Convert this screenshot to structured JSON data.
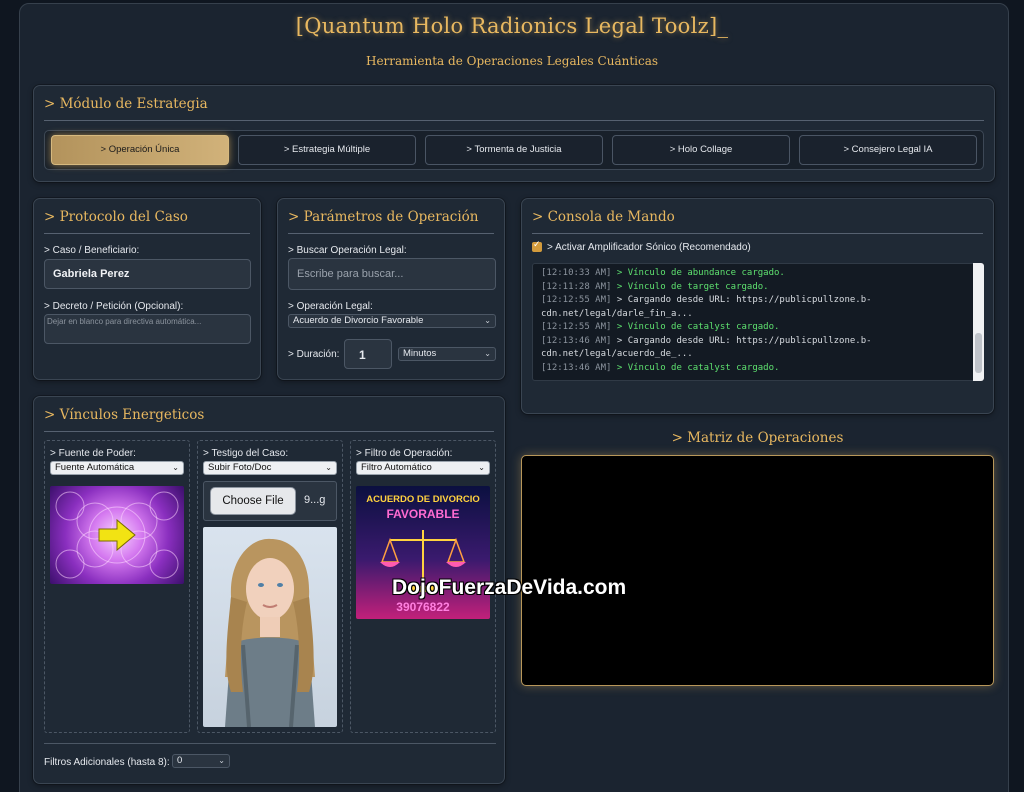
{
  "header": {
    "title": "[Quantum Holo Radionics Legal Toolz]_",
    "subtitle": "Herramienta de Operaciones Legales Cuánticas"
  },
  "strategy": {
    "title": "> Módulo de Estrategia",
    "tabs": [
      {
        "label": "> Operación Única",
        "active": true
      },
      {
        "label": "> Estrategia Múltiple",
        "active": false
      },
      {
        "label": "> Tormenta de Justicia",
        "active": false
      },
      {
        "label": "> Holo Collage",
        "active": false
      },
      {
        "label": "> Consejero Legal IA",
        "active": false
      }
    ]
  },
  "case_protocol": {
    "title": "> Protocolo del Caso",
    "beneficiary_label": "> Caso / Beneficiario:",
    "beneficiary_value": "Gabriela Perez",
    "decree_label": "> Decreto / Petición (Opcional):",
    "decree_placeholder": "Dejar en blanco para directiva automática..."
  },
  "operation_params": {
    "title": "> Parámetros de Operación",
    "search_label": "> Buscar Operación Legal:",
    "search_placeholder": "Escribe para buscar...",
    "operation_label": "> Operación Legal:",
    "operation_value": "Acuerdo de Divorcio Favorable",
    "duration_label": "> Duración:",
    "duration_value": "1",
    "duration_unit": "Minutos"
  },
  "console": {
    "title": "> Consola de Mando",
    "amp_label": "> Activar Amplificador Sónico (Recomendado)",
    "amp_checked": true,
    "lines": [
      {
        "ts": "[12:10:33 AM]",
        "msg": "> Vínculo de abundance cargado.",
        "kind": "ok"
      },
      {
        "ts": "[12:11:28 AM]",
        "msg": "> Vínculo de target cargado.",
        "kind": "ok"
      },
      {
        "ts": "[12:12:55 AM]",
        "msg": "> Cargando desde URL: https://publicpullzone.b-",
        "kind": "wh"
      },
      {
        "ts": "",
        "msg": "cdn.net/legal/darle_fin_a...",
        "kind": "wh"
      },
      {
        "ts": "[12:12:55 AM]",
        "msg": "> Vínculo de catalyst cargado.",
        "kind": "ok"
      },
      {
        "ts": "[12:13:46 AM]",
        "msg": "> Cargando desde URL: https://publicpullzone.b-",
        "kind": "wh"
      },
      {
        "ts": "",
        "msg": "cdn.net/legal/acuerdo_de_...",
        "kind": "wh"
      },
      {
        "ts": "[12:13:46 AM]",
        "msg": "> Vínculo de catalyst cargado.",
        "kind": "ok"
      }
    ]
  },
  "bonds": {
    "title": "> Vínculos Energeticos",
    "power_label": "> Fuente de Poder:",
    "power_value": "Fuente Automática",
    "witness_label": "> Testigo del Caso:",
    "witness_value": "Subir Foto/Doc",
    "choose_file": "Choose File",
    "file_name": "9...g",
    "filter_label": "> Filtro de Operación:",
    "filter_value": "Filtro Automático",
    "filter_card_line1": "ACUERDO DE DIVORCIO",
    "filter_card_line2": "FAVORABLE",
    "filter_card_number": "39076822",
    "extra_label": "Filtros Adicionales (hasta 8):",
    "extra_value": "0"
  },
  "matrix": {
    "title": "> Matriz de Operaciones"
  },
  "watermark": "DojoFuerzaDeVida.com",
  "colors": {
    "accent": "#e8b860",
    "console_ok": "#5ee06f",
    "panel_bg": "#1f2935"
  }
}
